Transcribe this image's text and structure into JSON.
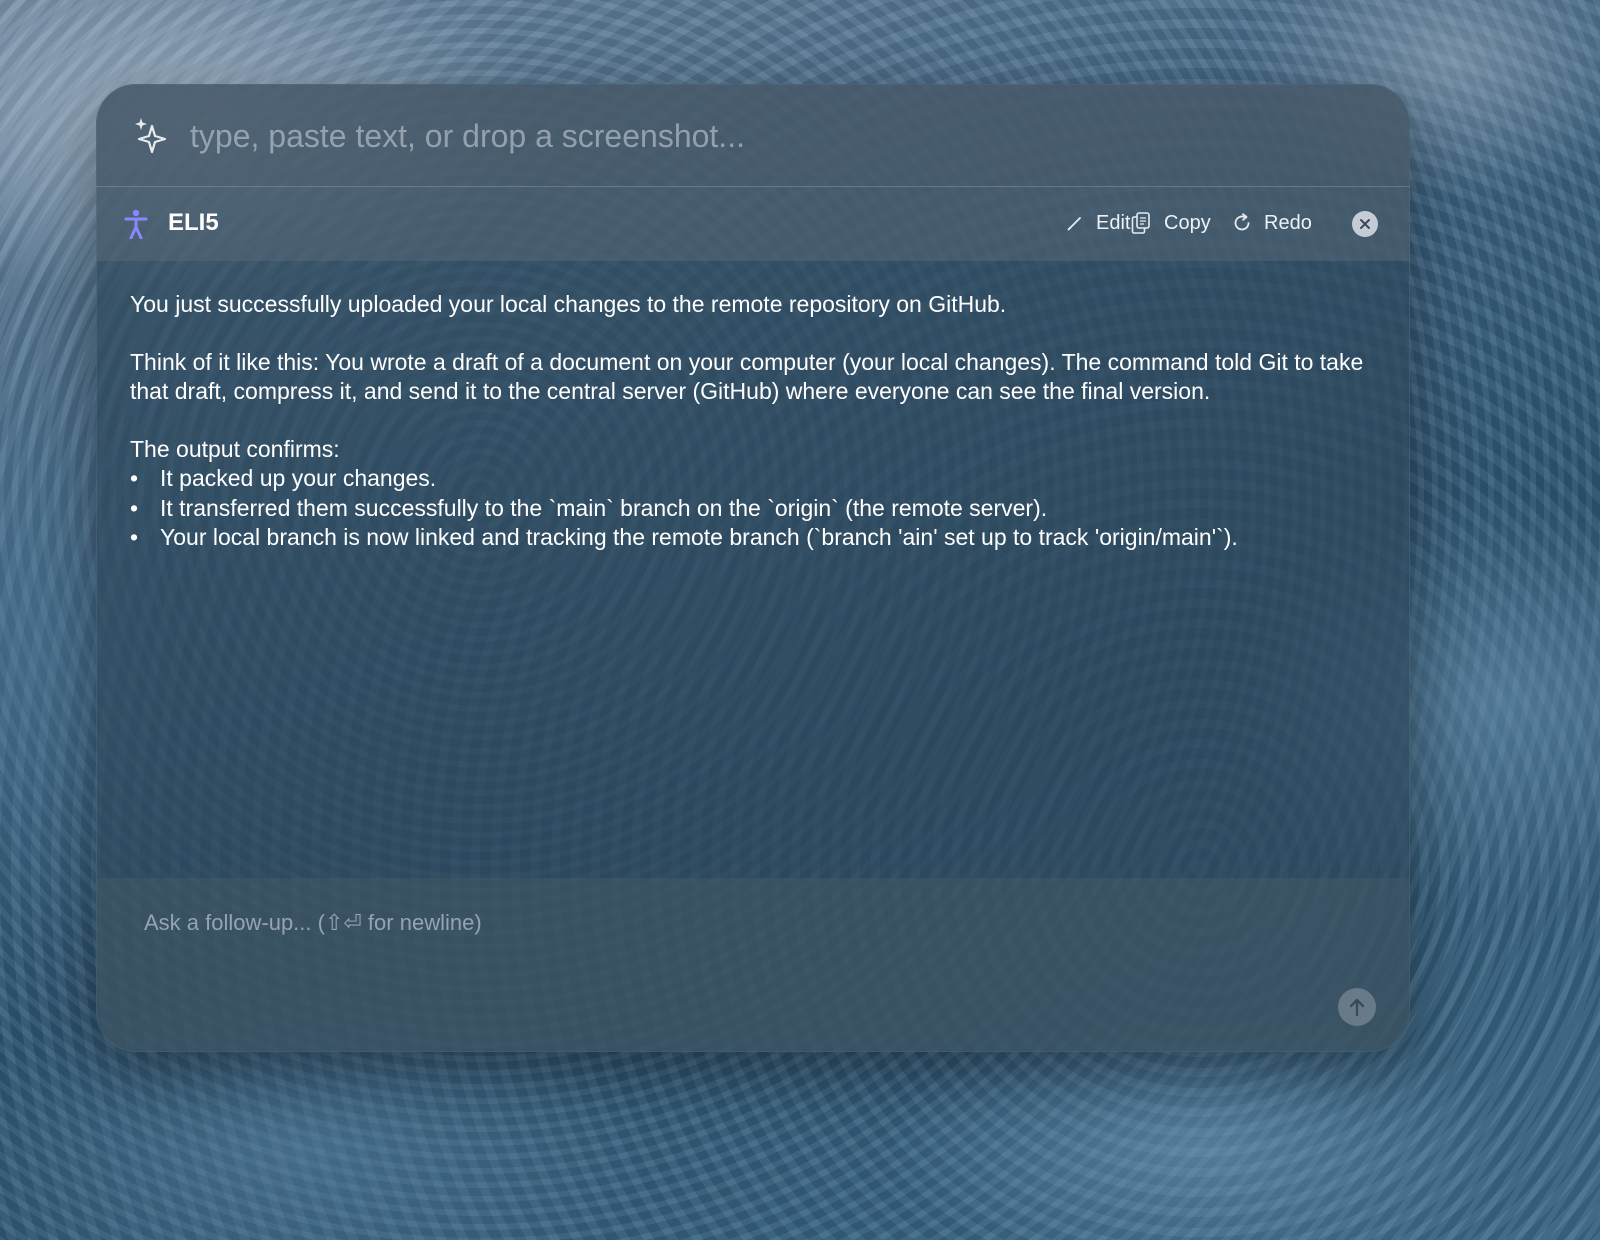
{
  "prompt": {
    "placeholder": "type, paste text, or drop a screenshot..."
  },
  "header": {
    "mode_title": "ELI5",
    "edit_label": "Edit",
    "copy_label": "Copy",
    "redo_label": "Redo"
  },
  "response": {
    "paragraphs": [
      "You just successfully uploaded your local changes to the remote repository on GitHub.",
      "Think of it like this: You wrote a draft of a document on your computer (your local changes). The command told Git to take that draft, compress it, and send it to the central server (GitHub) where everyone can see the final version."
    ],
    "confirm_intro": "The output confirms:",
    "bullets": [
      "It packed up your changes.",
      "It transferred them successfully to the `main` branch on the `origin` (the remote server).",
      "Your local branch is now linked and tracking the remote branch (`branch 'ain' set up to track 'origin/main'`)."
    ],
    "bullet_char": "•"
  },
  "followup": {
    "placeholder": "Ask a follow-up... (⇧⏎ for newline)"
  },
  "icons": {
    "prompt": "sparkle-icon",
    "mode": "person-icon",
    "edit": "pencil-icon",
    "copy": "copy-icon",
    "redo": "redo-icon",
    "close": "close-icon",
    "send": "arrow-up-icon"
  },
  "colors": {
    "mode_icon": "#8b86ff",
    "text": "#ffffff"
  }
}
